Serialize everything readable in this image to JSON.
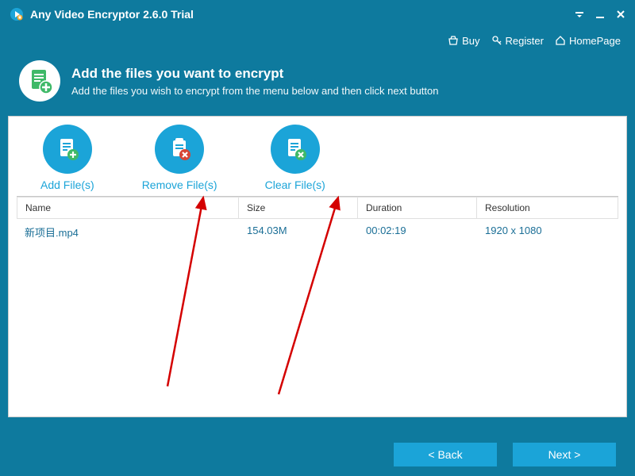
{
  "titlebar": {
    "title": "Any Video Encryptor 2.6.0 Trial"
  },
  "toolbar": {
    "buy": "Buy",
    "register": "Register",
    "homepage": "HomePage"
  },
  "header": {
    "title": "Add the files you want to encrypt",
    "subtitle": "Add the files you wish to encrypt from the menu below and then click next button"
  },
  "actions": {
    "add": "Add File(s)",
    "remove": "Remove File(s)",
    "clear": "Clear File(s)"
  },
  "table": {
    "headers": {
      "name": "Name",
      "size": "Size",
      "duration": "Duration",
      "resolution": "Resolution"
    },
    "rows": [
      {
        "name": "新项目.mp4",
        "size": "154.03M",
        "duration": "00:02:19",
        "resolution": "1920 x 1080"
      }
    ]
  },
  "footer": {
    "back": "< Back",
    "next": "Next >"
  }
}
